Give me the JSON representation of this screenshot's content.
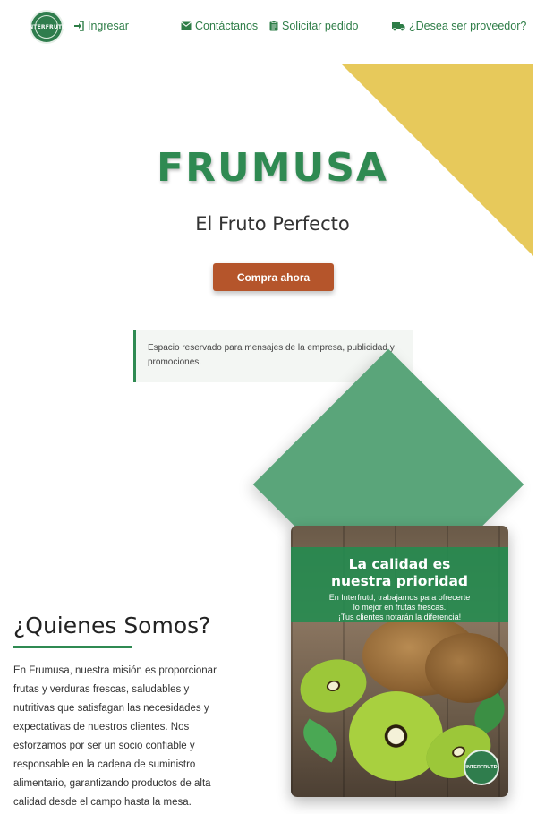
{
  "nav": {
    "logo_text": "INTERFRUTD",
    "login": "Ingresar",
    "contact": "Contáctanos",
    "order": "Solicitar pedido",
    "supplier": "¿Desea ser proveedor?"
  },
  "hero": {
    "brand": "FRUMUSA",
    "tagline": "El Fruto Perfecto",
    "cta": "Compra ahora"
  },
  "message": "Espacio reservado para mensajes de la empresa, publicidad y promociones.",
  "about": {
    "title": "¿Quienes Somos?",
    "text": "En Frumusa, nuestra misión es proporcionar frutas y verduras frescas, saludables y nutritivas que satisfagan las necesidades y expectativas de nuestros clientes. Nos esforzamos por ser un socio confiable y responsable en la cadena de suministro alimentario, garantizando productos de alta calidad desde el campo hasta la mesa."
  },
  "promo": {
    "title_line1": "La calidad es",
    "title_line2": "nuestra prioridad",
    "text_line1": "En Interfrutd, trabajamos para ofrecerte",
    "text_line2": "lo mejor en frutas frescas.",
    "text_line3": "¡Tus clientes notarán la diferencia!",
    "logo_text": "INTERFRUTD"
  },
  "colors": {
    "brand_green": "#2f8a52",
    "accent_yellow": "#e7c95b",
    "cta_orange": "#b5552b",
    "diamond_green": "#5aa57a"
  }
}
